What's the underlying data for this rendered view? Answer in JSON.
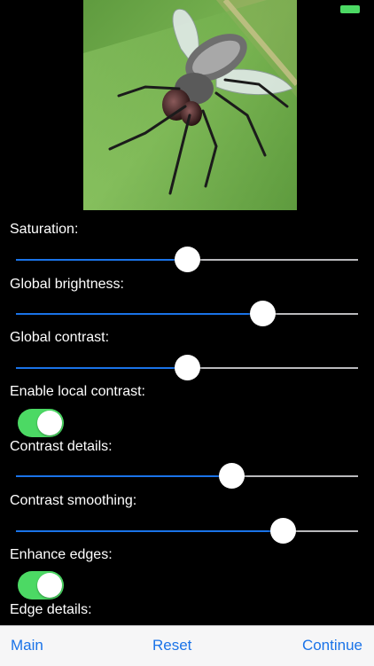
{
  "status": {
    "battery_color": "#4cd964"
  },
  "photo": {
    "subject": "housefly-photo"
  },
  "settings": [
    {
      "id": "saturation",
      "label": "Saturation:",
      "type": "slider",
      "value": 0.5
    },
    {
      "id": "global-brightness",
      "label": "Global brightness:",
      "type": "slider",
      "value": 0.72
    },
    {
      "id": "global-contrast",
      "label": "Global contrast:",
      "type": "slider",
      "value": 0.5
    },
    {
      "id": "enable-local-contrast",
      "label": "Enable local contrast:",
      "type": "toggle",
      "on": true
    },
    {
      "id": "contrast-details",
      "label": "Contrast details:",
      "type": "slider",
      "value": 0.63
    },
    {
      "id": "contrast-smoothing",
      "label": "Contrast smoothing:",
      "type": "slider",
      "value": 0.78
    },
    {
      "id": "enhance-edges",
      "label": "Enhance edges:",
      "type": "toggle",
      "on": true
    },
    {
      "id": "edge-details",
      "label": "Edge details:",
      "type": "label"
    }
  ],
  "toolbar": {
    "main_label": "Main",
    "reset_label": "Reset",
    "continue_label": "Continue"
  },
  "colors": {
    "accent": "#1a73e8",
    "toggle_on": "#4cd964",
    "track_off": "#b9b9bc"
  }
}
